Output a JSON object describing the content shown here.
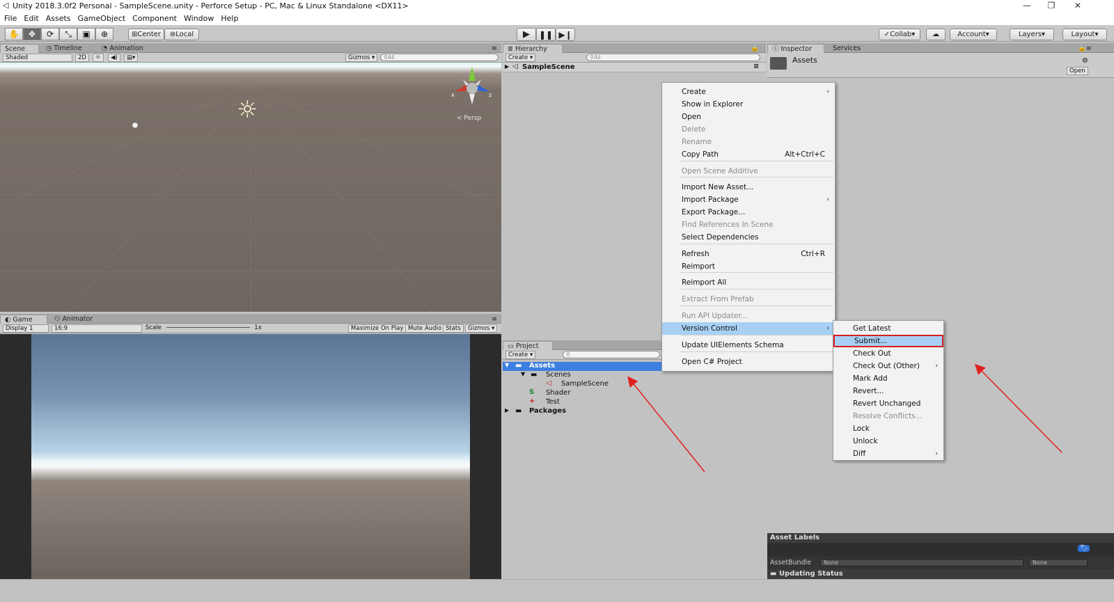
{
  "window": {
    "title": "Unity 2018.3.0f2 Personal - SampleScene.unity - Perforce Setup - PC, Mac & Linux Standalone <DX11>"
  },
  "menubar": [
    "File",
    "Edit",
    "Assets",
    "GameObject",
    "Component",
    "Window",
    "Help"
  ],
  "toolbar": {
    "pivot": "Center",
    "space": "Local",
    "collab": "Collab",
    "account": "Account",
    "layers": "Layers",
    "layout": "Layout"
  },
  "scene": {
    "tabs": [
      "Scene",
      "Timeline",
      "Animation"
    ],
    "shading": "Shaded",
    "mode2d": "2D",
    "gizmos": "Gizmos",
    "search": "All",
    "persp": "Persp",
    "axis_x": "x",
    "axis_z": "z"
  },
  "game": {
    "tabs": [
      "Game",
      "Animator"
    ],
    "display": "Display 1",
    "aspect": "16:9",
    "scale_label": "Scale",
    "scale_value": "1x",
    "maximize": "Maximize On Play",
    "mute": "Mute Audio",
    "stats": "Stats",
    "gizmos": "Gizmos"
  },
  "hierarchy": {
    "tab": "Hierarchy",
    "create": "Create",
    "search": "All",
    "scene": "SampleScene"
  },
  "project": {
    "tab": "Project",
    "create": "Create",
    "tree": [
      {
        "label": "Assets"
      },
      {
        "label": "Scenes"
      },
      {
        "label": "SampleScene"
      },
      {
        "label": "Shader"
      },
      {
        "label": "Test"
      },
      {
        "label": "Packages"
      }
    ]
  },
  "inspector": {
    "tabs": [
      "Inspector",
      "Services"
    ],
    "title": "Assets",
    "open": "Open",
    "asset_labels": "Asset Labels",
    "asset_bundle": "AssetBundle",
    "bundle_value": "None",
    "bundle_variant": "None",
    "updating": "Updating Status"
  },
  "context_menu": {
    "items": [
      {
        "label": "Create",
        "shortcut": ""
      },
      {
        "label": "Show in Explorer",
        "shortcut": ""
      },
      {
        "label": "Open",
        "shortcut": ""
      },
      {
        "label": "Delete",
        "shortcut": ""
      },
      {
        "label": "Rename",
        "shortcut": ""
      },
      {
        "label": "Copy Path",
        "shortcut": "Alt+Ctrl+C"
      },
      {
        "label": "Open Scene Additive",
        "shortcut": ""
      },
      {
        "label": "Import New Asset...",
        "shortcut": ""
      },
      {
        "label": "Import Package",
        "shortcut": ""
      },
      {
        "label": "Export Package...",
        "shortcut": ""
      },
      {
        "label": "Find References In Scene",
        "shortcut": ""
      },
      {
        "label": "Select Dependencies",
        "shortcut": ""
      },
      {
        "label": "Refresh",
        "shortcut": "Ctrl+R"
      },
      {
        "label": "Reimport",
        "shortcut": ""
      },
      {
        "label": "Reimport All",
        "shortcut": ""
      },
      {
        "label": "Extract From Prefab",
        "shortcut": ""
      },
      {
        "label": "Run API Updater...",
        "shortcut": ""
      },
      {
        "label": "Version Control",
        "shortcut": ""
      },
      {
        "label": "Update UIElements Schema",
        "shortcut": ""
      },
      {
        "label": "Open C# Project",
        "shortcut": ""
      }
    ]
  },
  "vc_submenu": {
    "items": [
      {
        "label": "Get Latest"
      },
      {
        "label": "Submit..."
      },
      {
        "label": "Check Out"
      },
      {
        "label": "Check Out (Other)"
      },
      {
        "label": "Mark Add"
      },
      {
        "label": "Revert..."
      },
      {
        "label": "Revert Unchanged"
      },
      {
        "label": "Resolve Conflicts..."
      },
      {
        "label": "Lock"
      },
      {
        "label": "Unlock"
      },
      {
        "label": "Diff"
      }
    ]
  },
  "colors": {
    "highlight": "#a8d0f4",
    "selection": "#3d7fe0",
    "annotation": "#e02020"
  }
}
